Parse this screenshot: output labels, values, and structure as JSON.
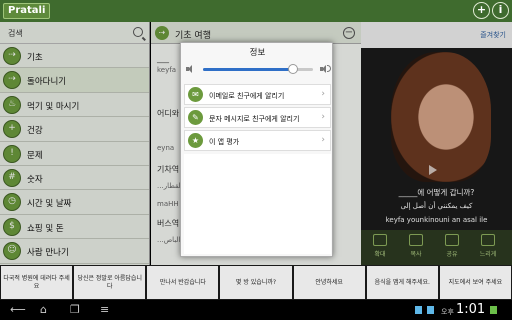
{
  "app": {
    "logo": "Pratali",
    "add_symbol": "+",
    "info_symbol": "i"
  },
  "sidebar": {
    "search_label": "검색",
    "items": [
      {
        "label": "기초",
        "icon": "⇢"
      },
      {
        "label": "돌아다니기",
        "icon": "⇢"
      },
      {
        "label": "먹기 및 마시기",
        "icon": "♨"
      },
      {
        "label": "건강",
        "icon": "+"
      },
      {
        "label": "문제",
        "icon": "!"
      },
      {
        "label": "숫자",
        "icon": "#"
      },
      {
        "label": "시간 및 날짜",
        "icon": "◷"
      },
      {
        "label": "쇼핑 및 돈",
        "icon": "$"
      },
      {
        "label": "사람 만나기",
        "icon": "☺"
      }
    ]
  },
  "middle": {
    "title": "기초 여행",
    "minus_symbol": "−",
    "rows": [
      {
        "text": "___",
        "sub": ""
      },
      {
        "text": "keyfa",
        "sub": ""
      },
      {
        "text": "어디와",
        "sub": ""
      },
      {
        "text": "eyna",
        "sub": ""
      },
      {
        "text": "기차역",
        "sub": ""
      },
      {
        "text": "...القطار",
        "sub": ""
      },
      {
        "text": "maHH",
        "sub": ""
      },
      {
        "text": "버스역",
        "sub": ""
      },
      {
        "text": "...الباص",
        "sub": ""
      }
    ]
  },
  "media": {
    "favorites_label": "즐겨찾기",
    "caption": "_____에 어떻게 갑니까?",
    "arabic": "كيف يمكنني أن أصل إلى",
    "transliteration": "keyfa younkinouni an asal ile",
    "controls": [
      "확대",
      "복사",
      "공유",
      "느리게"
    ]
  },
  "dialog": {
    "title": "정보",
    "volume": 0.82,
    "items": [
      {
        "label": "이메일로 친구에게 알리기",
        "icon": "✉"
      },
      {
        "label": "문자 메시지로 친구에게 알리기",
        "icon": "✎"
      },
      {
        "label": "이 앱 평가",
        "icon": "★"
      }
    ],
    "chevron": "›"
  },
  "phrase_strip": [
    "다국적 병원에 데려다 주세요",
    "당신은 정말로 아름답습니다",
    "만나서 반갑습니다",
    "몇 방 있습니까?",
    "안녕하세요",
    "음식을 맵게 해주세요.",
    "지도에서 보여 주세요"
  ],
  "system_bar": {
    "ampm": "오후",
    "time": "1:01"
  },
  "colors": {
    "brand_green": "#3f6b2e",
    "accent_blue": "#2f6fc7"
  }
}
